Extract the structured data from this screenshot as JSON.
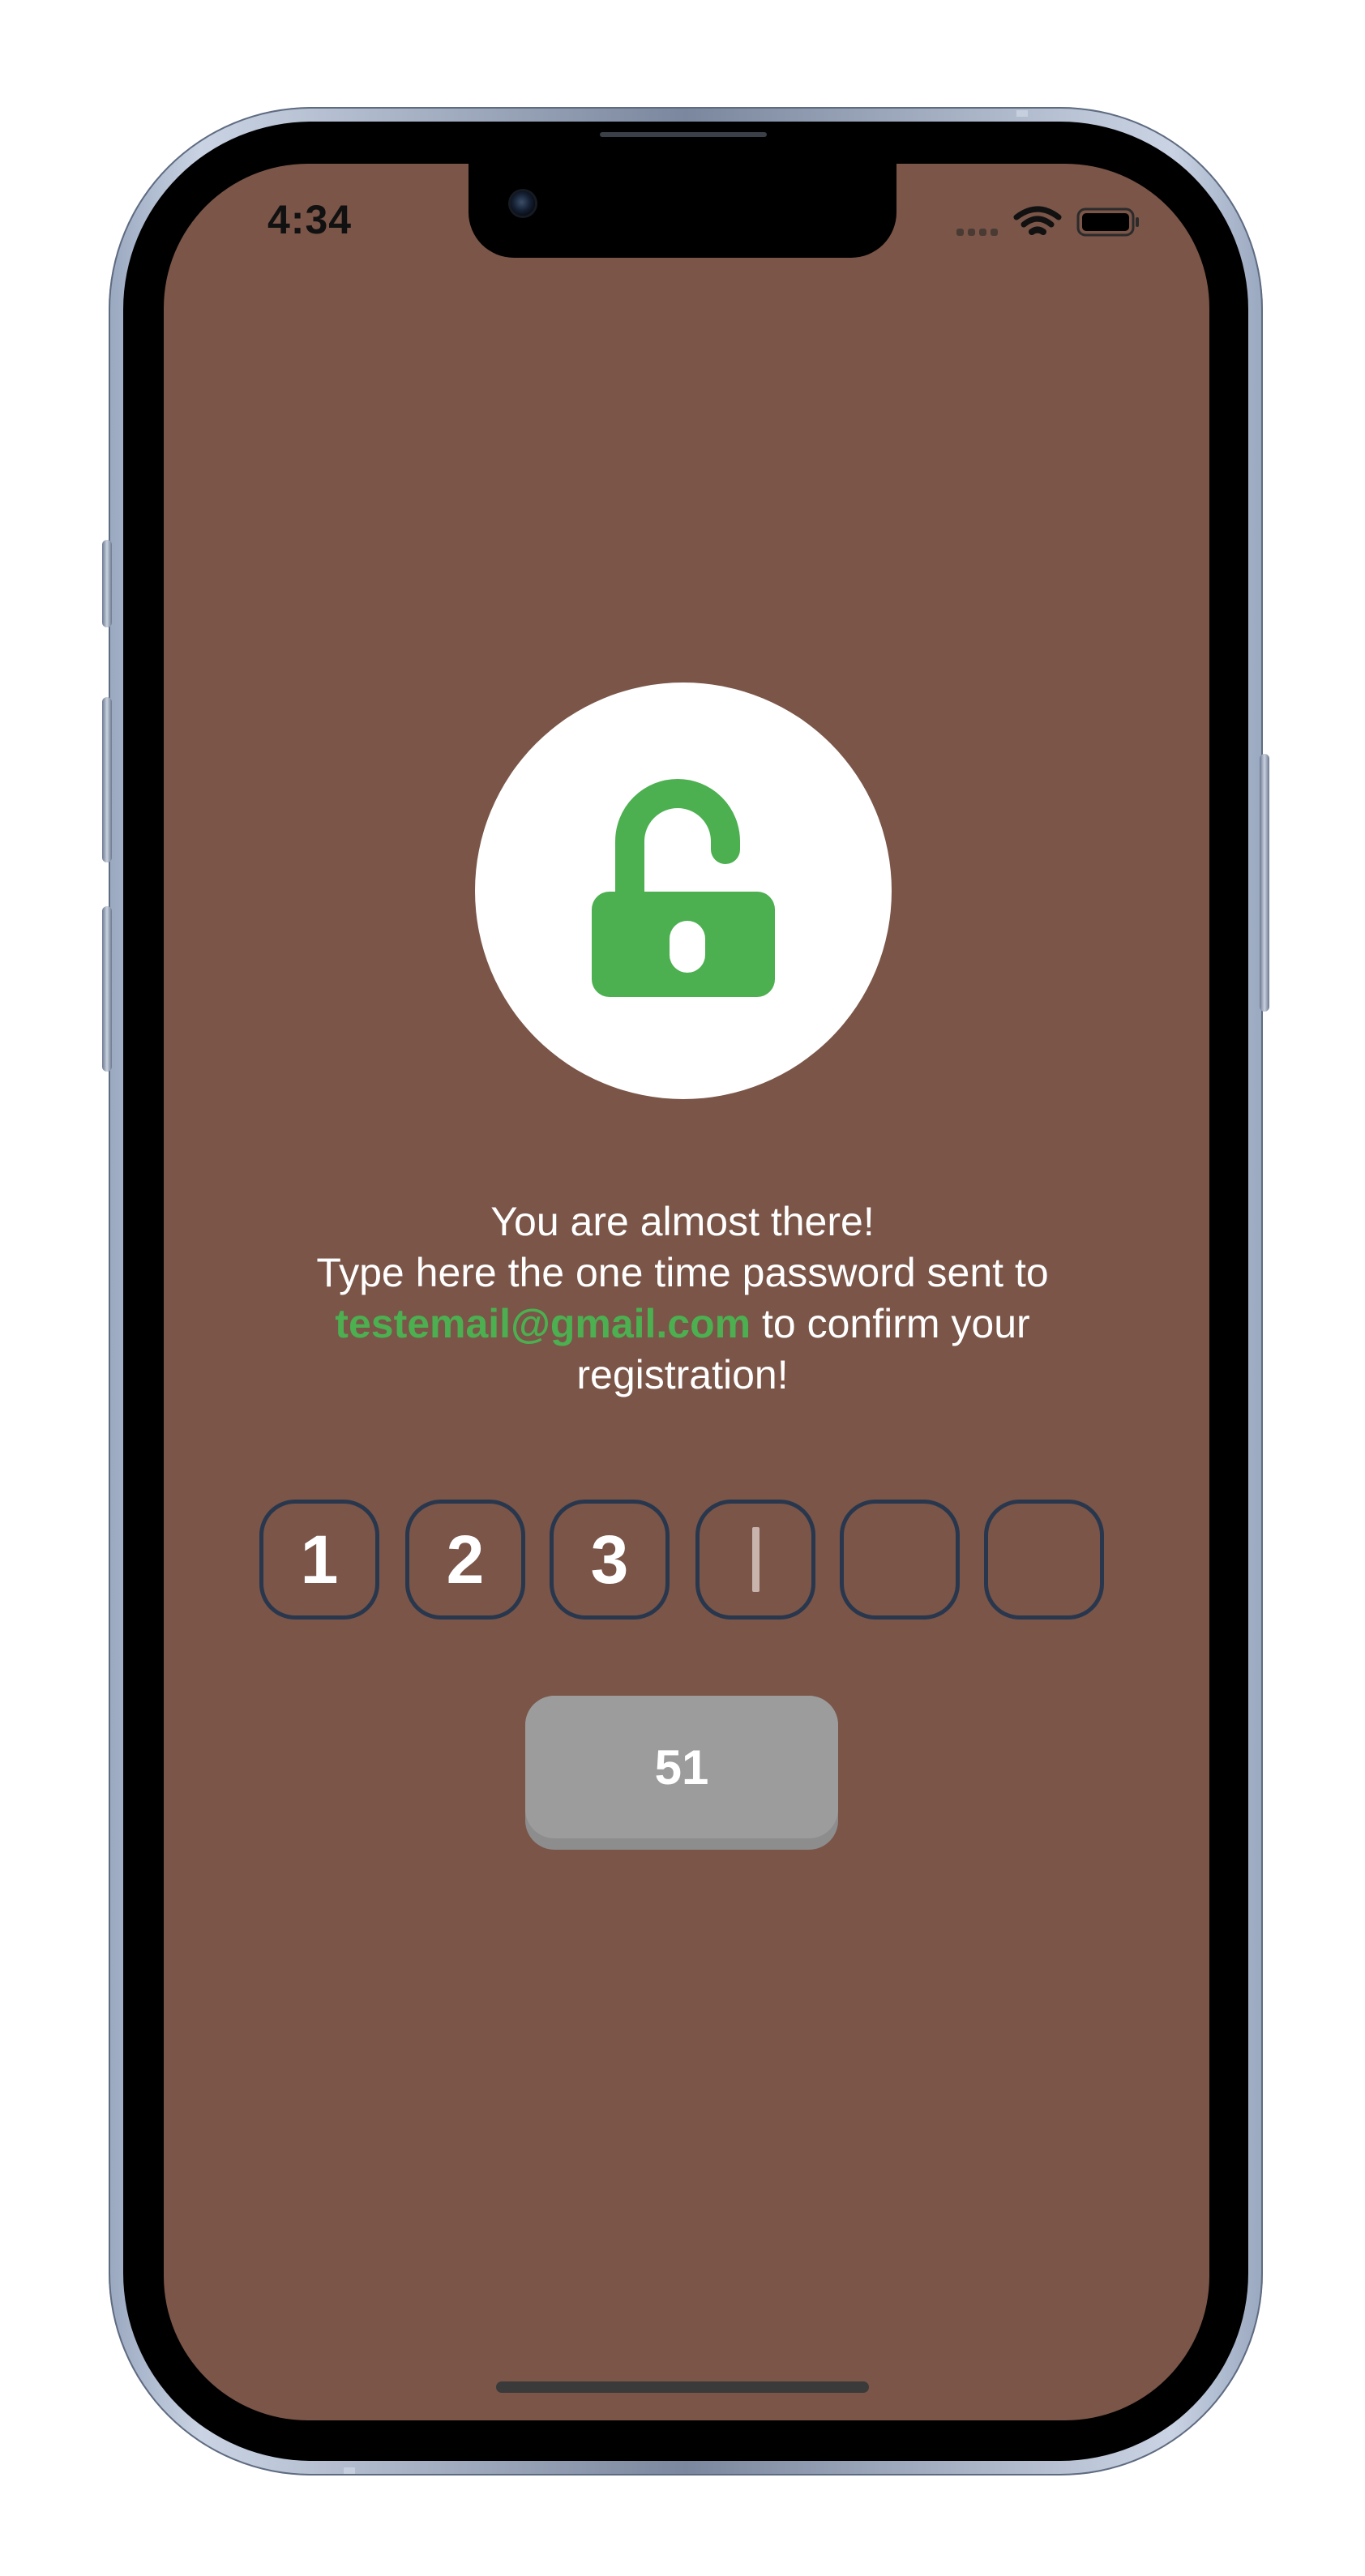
{
  "status_bar": {
    "time": "4:34"
  },
  "lock_icon": {
    "name": "unlocked-padlock-icon",
    "color": "#4caf50"
  },
  "message": {
    "line1": "You are almost there!",
    "line2": "Type here the one time password sent to",
    "email": "testemail@gmail.com",
    "line3_rest": " to confirm your",
    "line4": "registration!"
  },
  "otp": {
    "digits": [
      "1",
      "2",
      "3",
      "",
      "",
      ""
    ],
    "active_index": 3
  },
  "timer_button": {
    "label": "51"
  },
  "colors": {
    "screen_background": "#7a5548",
    "accent_green": "#4caf50",
    "otp_border": "#28374d",
    "button_gray": "#9c9c9c"
  }
}
